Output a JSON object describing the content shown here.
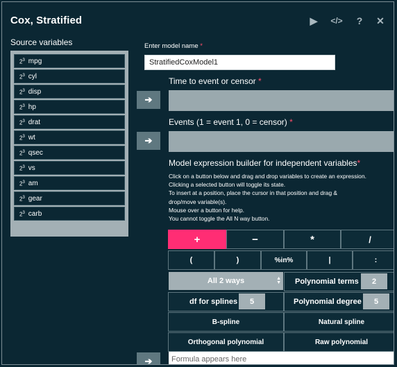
{
  "window": {
    "title": "Cox, Stratified",
    "icons": [
      "play-icon",
      "code-icon",
      "help-icon",
      "close-icon"
    ],
    "icon_glyphs": {
      "play": "▶",
      "code": "</>",
      "help": "?",
      "close": "✕"
    }
  },
  "source": {
    "label": "Source variables",
    "type_glyph_base": "2",
    "type_glyph_sup": "3",
    "variables": [
      "mpg",
      "cyl",
      "disp",
      "hp",
      "drat",
      "wt",
      "qsec",
      "vs",
      "am",
      "gear",
      "carb"
    ]
  },
  "model_name": {
    "label": "Enter model name",
    "required_mark": "*",
    "value": "StratifiedCoxModel1"
  },
  "time_field": {
    "label": "Time to event or censor",
    "required_mark": "*"
  },
  "events_field": {
    "label": "Events (1 = event 1, 0 = censor)",
    "required_mark": "*"
  },
  "arrow_glyph": "➔",
  "builder": {
    "label": "Model expression builder for independent variables",
    "required_mark": "*",
    "help_lines": [
      "Click on a button below and drag and drop variables to create an expression.",
      "Clicking a selected button will toggle its state.",
      "To insert at a position, place the cursor in that position and drag &",
      "drop/move variable(s).",
      "Mouse over a button for help.",
      "You cannot toggle the All N way button."
    ],
    "ops_row1": [
      "+",
      "−",
      "*",
      "/"
    ],
    "ops_row2": [
      "(",
      ")",
      "%in%",
      "|",
      ":"
    ],
    "all_ways": "All 2 ways",
    "poly_terms_label": "Polynomial terms",
    "poly_terms_value": "2",
    "df_splines_label": "df for splines",
    "df_splines_value": "5",
    "poly_degree_label": "Polynomial degree",
    "poly_degree_value": "5",
    "bspline": "B-spline",
    "natural_spline": "Natural spline",
    "orthogonal_polynomial": "Orthogonal polynomial",
    "raw_polynomial": "Raw polynomial",
    "active_color": "#ff2d74"
  },
  "formula": {
    "placeholder": "Formula appears here"
  }
}
